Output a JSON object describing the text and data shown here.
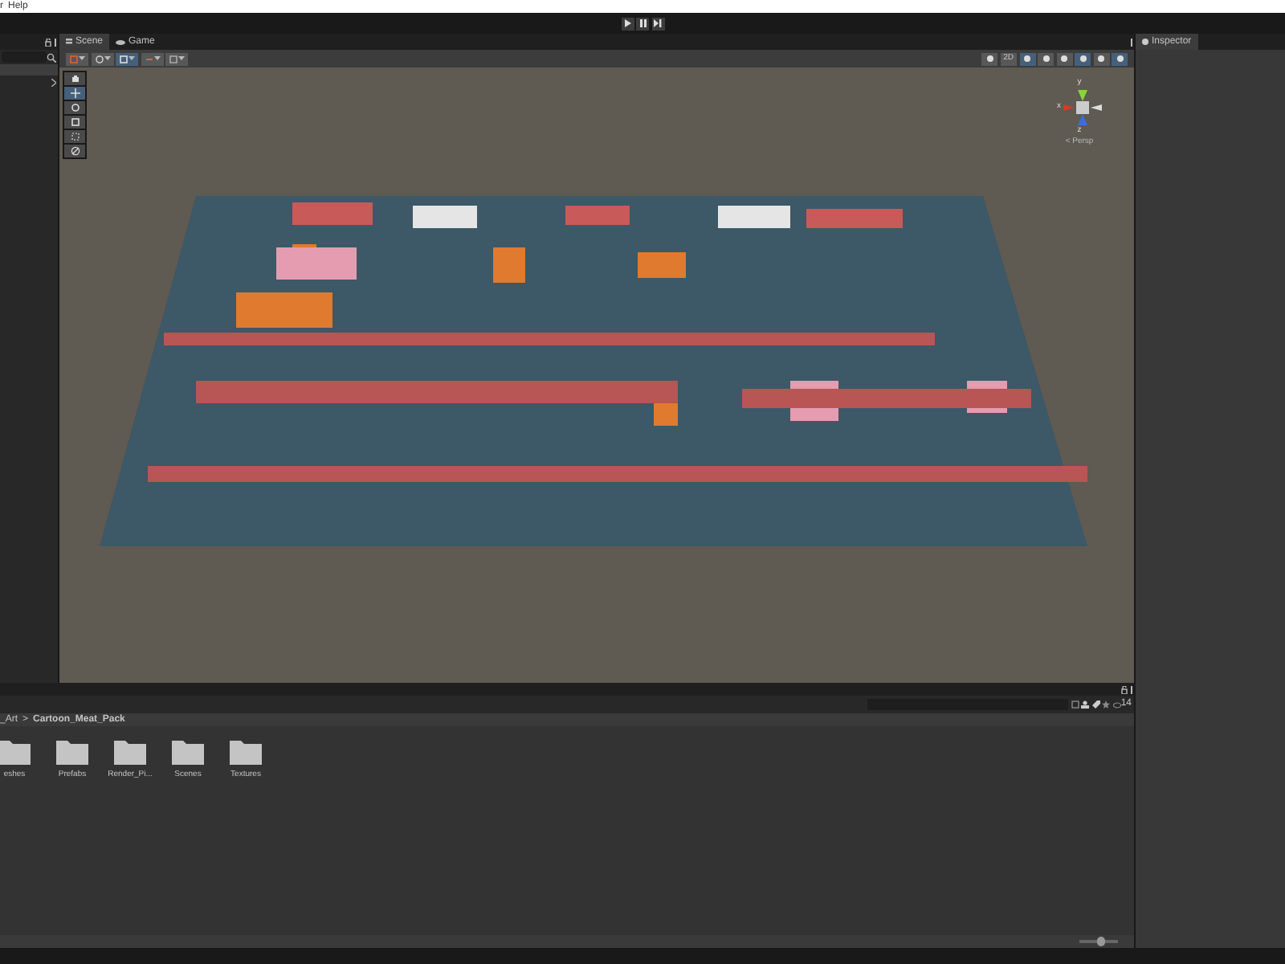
{
  "menu": [
    {
      "label": "r"
    },
    {
      "label": "Help"
    }
  ],
  "scene_tabs": [
    {
      "label": "Scene",
      "selected": true
    },
    {
      "label": "Game",
      "selected": false
    }
  ],
  "scene_left_tools": [
    {
      "selected": false
    },
    {
      "selected": false
    },
    {
      "selected": true
    },
    {
      "selected": false
    },
    {
      "selected": false
    }
  ],
  "scene_right_tools": [
    {
      "kind": "icon",
      "selected": false
    },
    {
      "kind": "text",
      "label": "2D",
      "selected": false
    },
    {
      "kind": "icon",
      "selected": true
    },
    {
      "kind": "icon",
      "selected": false
    },
    {
      "kind": "icon",
      "selected": false
    },
    {
      "kind": "icon",
      "selected": true
    },
    {
      "kind": "icon",
      "selected": false
    },
    {
      "kind": "icon",
      "selected": true
    }
  ],
  "tools": [
    {
      "selected": false
    },
    {
      "selected": true
    },
    {
      "selected": false
    },
    {
      "selected": false
    },
    {
      "selected": false
    },
    {
      "selected": false
    }
  ],
  "gizmo": {
    "top_axis": "y",
    "left_axis": "x",
    "bottom_axis": "z",
    "projection": "< Persp"
  },
  "inspector_tab": {
    "label": "Inspector",
    "selected": true
  },
  "project": {
    "breadcrumb": [
      "_Art",
      "Cartoon_Meat_Pack"
    ],
    "breadcrumb_separator": ">",
    "visible_count": "14",
    "folders": [
      {
        "name": "eshes"
      },
      {
        "name": "Prefabs"
      },
      {
        "name": "Render_Pi..."
      },
      {
        "name": "Scenes"
      },
      {
        "name": "Textures"
      }
    ],
    "zoom_slider": {
      "level": 0.55
    }
  }
}
